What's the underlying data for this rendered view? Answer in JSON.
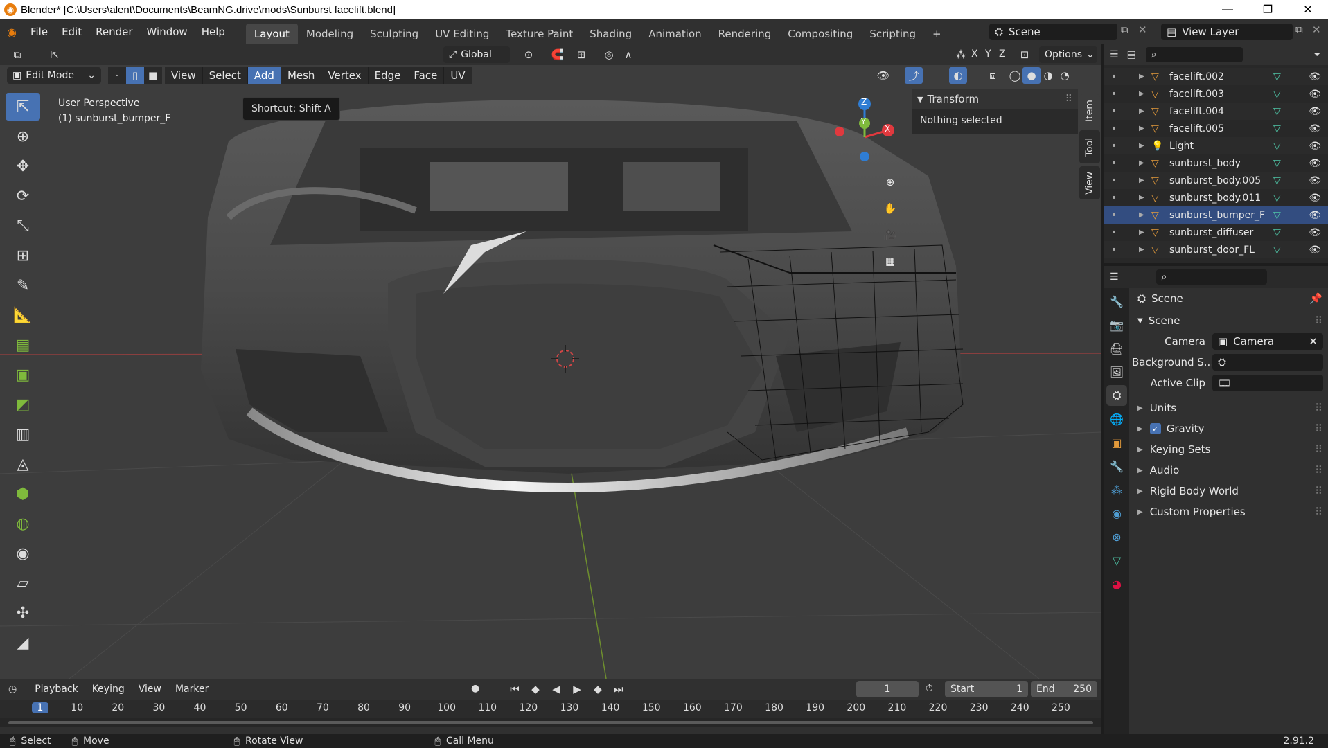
{
  "window": {
    "title": "Blender* [C:\\Users\\alent\\Documents\\BeamNG.drive\\mods\\Sunburst facelift.blend]",
    "minimize": "—",
    "maximize": "❐",
    "close": "✕"
  },
  "menu": [
    "File",
    "Edit",
    "Render",
    "Window",
    "Help"
  ],
  "workspaces": [
    "Layout",
    "Modeling",
    "Sculpting",
    "UV Editing",
    "Texture Paint",
    "Shading",
    "Animation",
    "Rendering",
    "Compositing",
    "Scripting"
  ],
  "active_workspace": "Layout",
  "scene_field": "Scene",
  "view_layer_field": "View Layer",
  "viewport": {
    "transform_orientation": "Global",
    "options_label": "Options",
    "mode": "Edit Mode",
    "menus": [
      "View",
      "Select",
      "Add",
      "Mesh",
      "Vertex",
      "Edge",
      "Face",
      "UV"
    ],
    "active_menu": "Add",
    "tooltip": "Shortcut: Shift A",
    "perspective_label": "User Perspective",
    "object_label": "(1) sunburst_bumper_F",
    "gizmo_axes": {
      "z": "Z",
      "y": "Y",
      "x": "X"
    },
    "axis_lock": [
      "X",
      "Y",
      "Z"
    ]
  },
  "sidebar": {
    "panel_title": "Transform",
    "panel_text": "Nothing selected",
    "tabs": [
      "Item",
      "Tool",
      "View"
    ]
  },
  "outliner": {
    "rows": [
      {
        "name": "facelift.002",
        "selected": false
      },
      {
        "name": "facelift.003",
        "selected": false
      },
      {
        "name": "facelift.004",
        "selected": false
      },
      {
        "name": "facelift.005",
        "selected": false
      },
      {
        "name": "Light",
        "selected": false
      },
      {
        "name": "sunburst_body",
        "selected": false
      },
      {
        "name": "sunburst_body.005",
        "selected": false
      },
      {
        "name": "sunburst_body.011",
        "selected": false
      },
      {
        "name": "sunburst_bumper_F",
        "selected": true
      },
      {
        "name": "sunburst_diffuser",
        "selected": false
      },
      {
        "name": "sunburst_door_FL",
        "selected": false
      }
    ]
  },
  "properties": {
    "breadcrumb": "Scene",
    "section": "Scene",
    "camera_label": "Camera",
    "camera_value": "Camera",
    "background_label": "Background S...",
    "active_clip_label": "Active Clip",
    "panels": [
      "Units",
      "Gravity",
      "Keying Sets",
      "Audio",
      "Rigid Body World",
      "Custom Properties"
    ],
    "gravity_checked": true
  },
  "timeline": {
    "menus": [
      "Playback",
      "Keying",
      "View",
      "Marker"
    ],
    "current_frame": "1",
    "start_label": "Start",
    "start_value": "1",
    "end_label": "End",
    "end_value": "250",
    "ruler": [
      "1",
      "10",
      "20",
      "30",
      "40",
      "50",
      "60",
      "70",
      "80",
      "90",
      "100",
      "110",
      "120",
      "130",
      "140",
      "150",
      "160",
      "170",
      "180",
      "190",
      "200",
      "210",
      "220",
      "230",
      "240",
      "250"
    ]
  },
  "statusbar": {
    "items": [
      "Select",
      "Move",
      "Rotate View",
      "Call Menu"
    ],
    "version": "2.91.2"
  },
  "colors": {
    "accent": "#4772b3",
    "header": "#303030",
    "viewport": "#3d3d3d",
    "outliner_selected": "#334d80",
    "gizmo_x": "#e0393e",
    "gizmo_y": "#7fba3c",
    "gizmo_z": "#2f7dd3",
    "mesh_icon": "#4fc7a8",
    "object_icon": "#e39a3b"
  }
}
